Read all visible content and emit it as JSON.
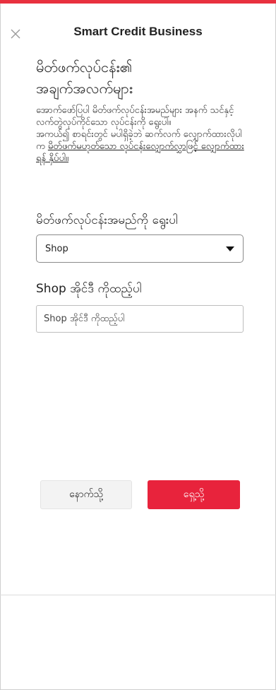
{
  "header": {
    "title": "Smart Credit Business",
    "close_icon": "close-icon"
  },
  "page": {
    "heading_line1": "မိတ်ဖက်လုပ်ငန်း၏",
    "heading_line2": "အချက်အလက်များ",
    "desc_main": "အောက်ဖော်ပြပါ မိတ်ဖက်လုပ်ငန်းအမည်များ အနက် သင်နှင့် လက်တွဲလုပ်ကိုင်သော လုပ်ငန်းကို ရွေးပါ။",
    "desc_second": "အကယ်၍ စာရင်းတွင် မပါရှိခဲ့ဘဲ ဆက်လက် လျှောက်ထားလိုပါက ",
    "desc_link": "မိတ်ဖက်မဟုတ်သော လုပ်ငန်းလျှောက်လွှာဖြင့် လျှောက်ထားရန် နှိပ်ပါ။"
  },
  "form": {
    "select_label": "မိတ်ဖက်လုပ်ငန်းအမည်ကို ရွေးပါ",
    "select_value": "Shop",
    "input_label": "Shop အိုင်ဒီ ကိုထည့်ပါ",
    "input_value": "",
    "input_placeholder": "Shop အိုင်ဒီ ကိုထည့်ပါ"
  },
  "actions": {
    "back_label": "နောက်သို့",
    "next_label": "ရှေ့သို့"
  },
  "colors": {
    "accent": "#e8233c",
    "top_bar": "#e8313f"
  }
}
